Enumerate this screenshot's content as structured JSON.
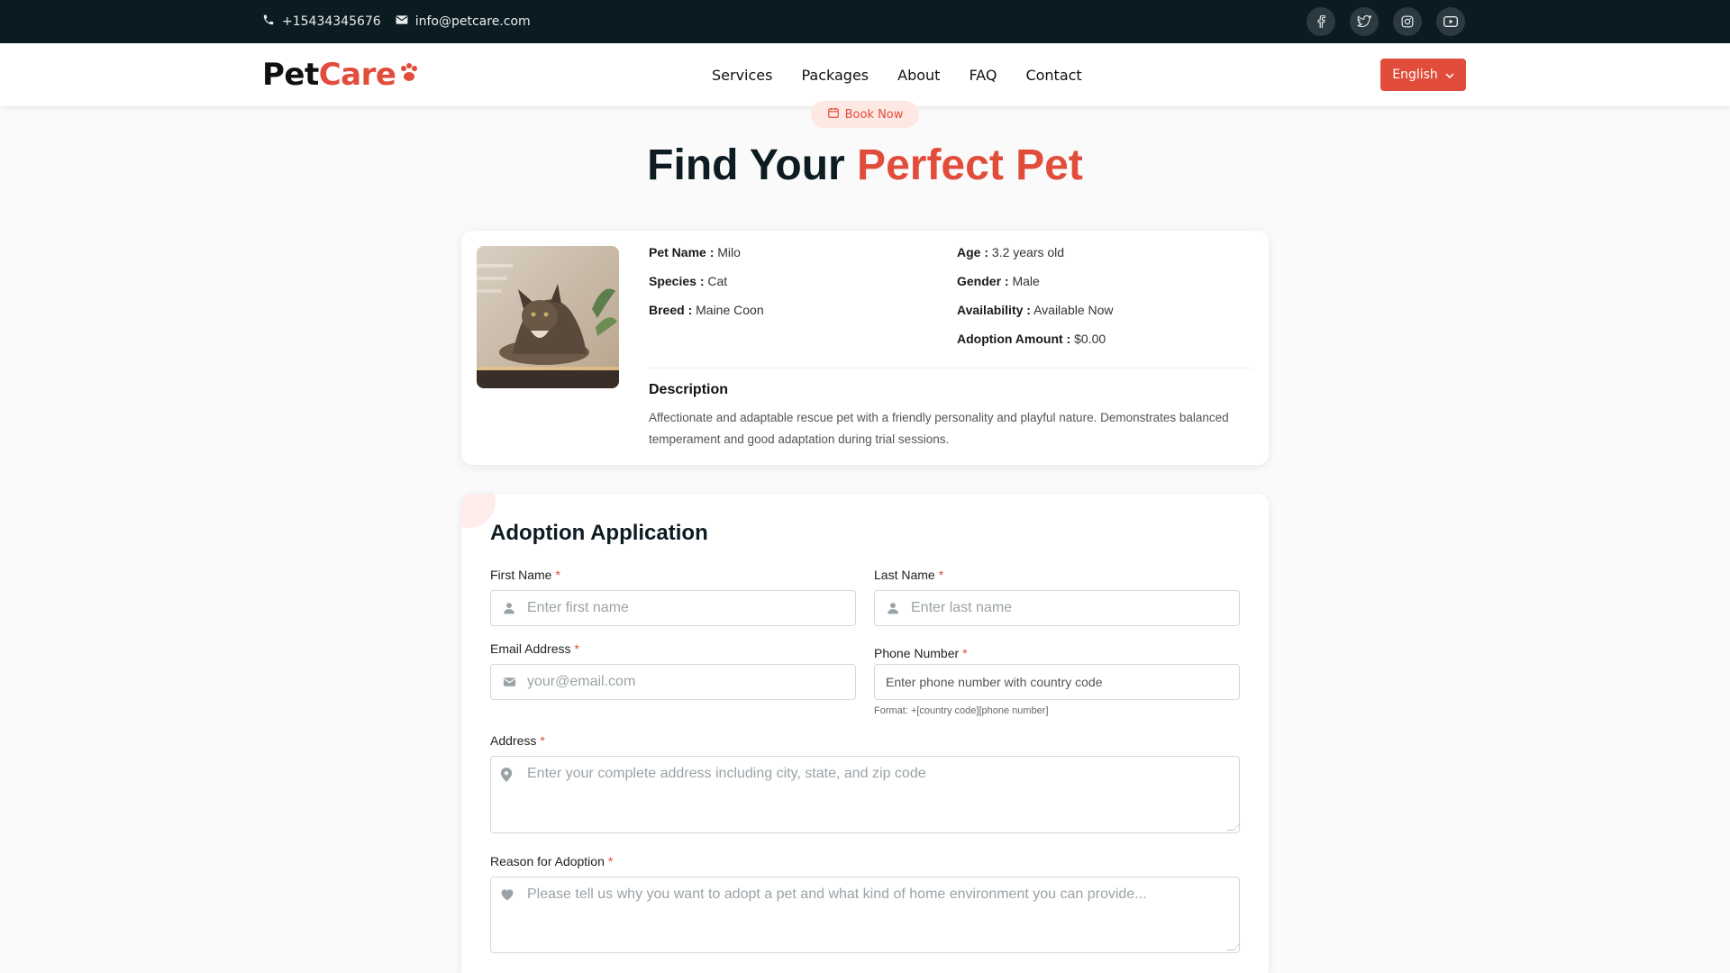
{
  "topbar": {
    "phone": "+15434345676",
    "email": "info@petcare.com",
    "socials": [
      "facebook-icon",
      "twitter-icon",
      "instagram-icon",
      "youtube-icon"
    ]
  },
  "nav": {
    "logo_part1": "Pet",
    "logo_part2": "Care",
    "items": [
      {
        "label": "Services"
      },
      {
        "label": "Packages"
      },
      {
        "label": "About"
      },
      {
        "label": "FAQ"
      },
      {
        "label": "Contact"
      }
    ],
    "language": "English"
  },
  "hero": {
    "badge": "Book Now",
    "title_part1": "Find Your",
    "title_part2": "Perfect Pet"
  },
  "pet": {
    "fields": {
      "name_label": "Pet Name :",
      "name_value": "Milo",
      "species_label": "Species :",
      "species_value": "Cat",
      "breed_label": "Breed :",
      "breed_value": "Maine Coon",
      "age_label": "Age :",
      "age_value": "3.2 years old",
      "gender_label": "Gender :",
      "gender_value": "Male",
      "availability_label": "Availability :",
      "availability_value": "Available Now",
      "amount_label": "Adoption Amount :",
      "amount_value": "$0.00"
    },
    "description_title": "Description",
    "description_text": "Affectionate and adaptable rescue pet with a friendly personality and playful nature. Demonstrates balanced temperament and good adaptation during trial sessions."
  },
  "form": {
    "title": "Adoption Application",
    "first_name_label": "First Name",
    "first_name_placeholder": "Enter first name",
    "last_name_label": "Last Name",
    "last_name_placeholder": "Enter last name",
    "email_label": "Email Address",
    "email_placeholder": "your@email.com",
    "phone_label": "Phone Number",
    "phone_placeholder": "Enter phone number with country code",
    "phone_hint": "Format: +[country code][phone number]",
    "address_label": "Address",
    "address_placeholder": "Enter your complete address including city, state, and zip code",
    "reason_label": "Reason for Adoption",
    "reason_placeholder": "Please tell us why you want to adopt a pet and what kind of home environment you can provide...",
    "required_mark": "*"
  },
  "colors": {
    "accent": "#e24c3b",
    "topbar_bg": "#0b1b22"
  }
}
